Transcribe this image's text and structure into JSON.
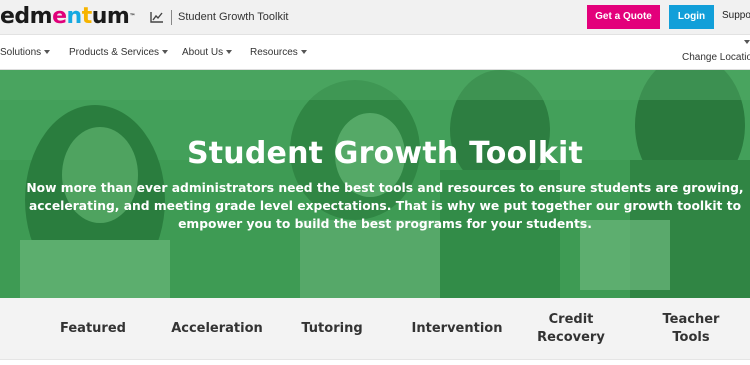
{
  "header": {
    "logo_parts": [
      "edm",
      "e",
      "n",
      "t",
      "u",
      "m"
    ],
    "logo_tm": "™",
    "breadcrumb_icon": "chart-line-icon",
    "breadcrumb_title": "Student Growth Toolkit",
    "quote_label": "Get a Quote",
    "login_label": "Login",
    "support_label": "Suppo",
    "quote_color": "#e3007b",
    "login_color": "#129fd9"
  },
  "nav": {
    "items": [
      {
        "label": "Solutions"
      },
      {
        "label": "Products & Services"
      },
      {
        "label": "About Us"
      },
      {
        "label": "Resources"
      }
    ],
    "change_location": "Change Location"
  },
  "hero": {
    "title": "Student Growth Toolkit",
    "description": "Now more than ever administrators need the best tools and resources to ensure students are growing, accelerating, and meeting grade level expectations. That is why we put together our growth toolkit to empower you to build the best programs for your students.",
    "overlay_color": "#3e9a55"
  },
  "tabs": [
    {
      "label": "Featured"
    },
    {
      "label": "Acceleration"
    },
    {
      "label": "Tutoring"
    },
    {
      "label": "Intervention"
    },
    {
      "label": "Credit Recovery"
    },
    {
      "label": "Teacher Tools"
    }
  ]
}
